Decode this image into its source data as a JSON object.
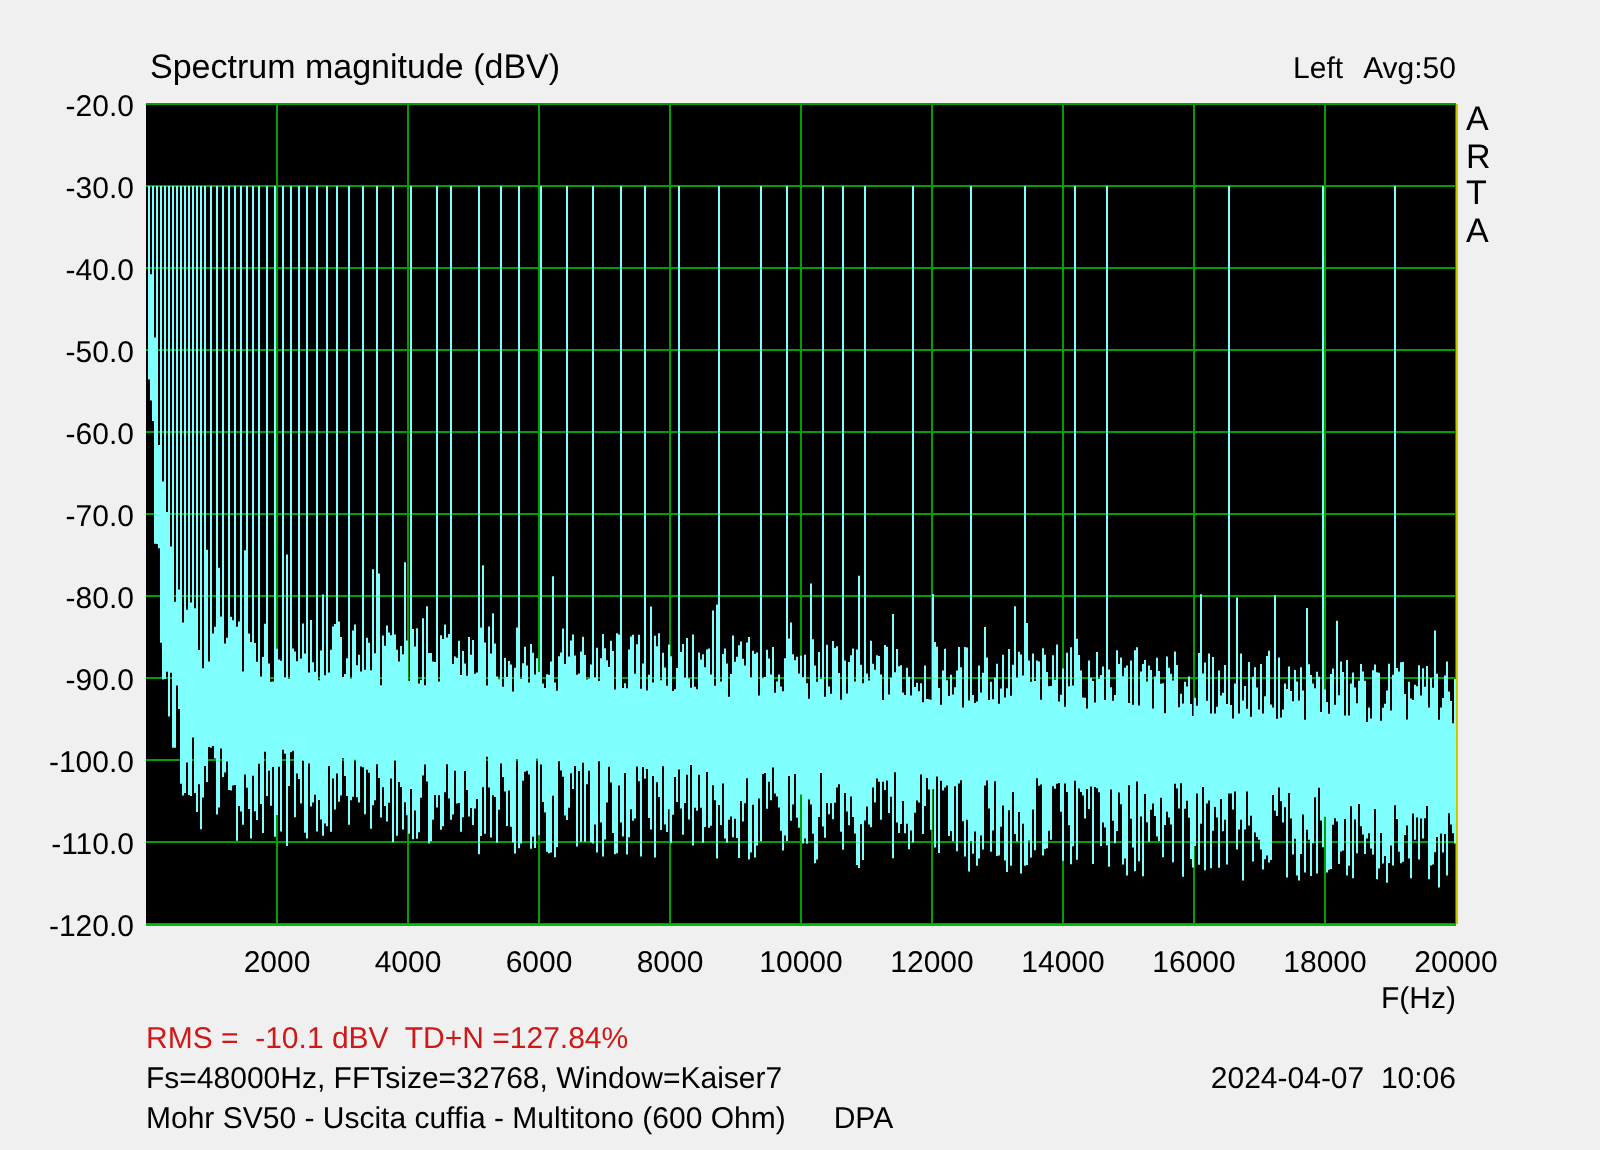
{
  "header": {
    "channel": "Left",
    "average": "Avg:50"
  },
  "chart_data": {
    "type": "line",
    "title": "Spectrum magnitude (dBV)",
    "xlabel": "F(Hz)",
    "xlim": [
      0,
      20000
    ],
    "ylim": [
      -120,
      -20
    ],
    "grid": true,
    "xticks": [
      2000,
      4000,
      6000,
      8000,
      10000,
      12000,
      14000,
      16000,
      18000,
      20000
    ],
    "yticks": [
      {
        "value": -20,
        "label": "-20.0"
      },
      {
        "value": -30,
        "label": "-30.0"
      },
      {
        "value": -40,
        "label": "-40.0"
      },
      {
        "value": -50,
        "label": "-50.0"
      },
      {
        "value": -60,
        "label": "-60.0"
      },
      {
        "value": -70,
        "label": "-70.0"
      },
      {
        "value": -80,
        "label": "-80.0"
      },
      {
        "value": -90,
        "label": "-90.0"
      },
      {
        "value": -100,
        "label": "-100.0"
      },
      {
        "value": -110,
        "label": "-110.0"
      },
      {
        "value": -120,
        "label": "-120.0"
      }
    ]
  },
  "logo": "ARTA",
  "footer": {
    "summary": "RMS =  -10.1 dBV  TD+N =127.84%",
    "parameters": "Fs=48000Hz, FFTsize=32768, Window=Kaiser7",
    "timestamp": "2024-04-07  10:06",
    "description": "Mohr SV50 - Uscita cuffia - Multitono (600 Ohm)",
    "tag": "DPA"
  }
}
